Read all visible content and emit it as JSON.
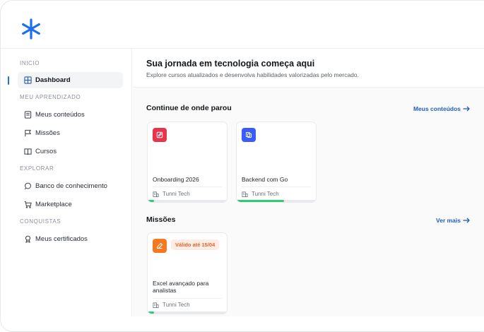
{
  "brand": {
    "logo_color": "#1f6feb"
  },
  "sidebar": {
    "sections": [
      {
        "label": "INICIO"
      },
      {
        "label": "MEU APRENDIZADO"
      },
      {
        "label": "EXPLORAR"
      },
      {
        "label": "CONQUISTAS"
      }
    ],
    "items": [
      {
        "label": "Dashboard",
        "icon": "grid-icon",
        "active": true
      },
      {
        "label": "Meus conteúdos",
        "icon": "book-icon"
      },
      {
        "label": "Missões",
        "icon": "flag-icon"
      },
      {
        "label": "Cursos",
        "icon": "open-book-icon"
      },
      {
        "label": "Banco de conhecimento",
        "icon": "search-icon"
      },
      {
        "label": "Marketplace",
        "icon": "cart-icon"
      },
      {
        "label": "Meus certificados",
        "icon": "award-icon"
      }
    ]
  },
  "hero": {
    "title": "Sua jornada em tecnologia começa aqui",
    "subtitle": "Explore cursos atualizados e desenvolva habilidades valorizadas pelo mercado."
  },
  "continue_section": {
    "title": "Continue de onde parou",
    "link": "Meus conteúdos",
    "cards": [
      {
        "title": "Onboarding 2026",
        "org": "Tunni Tech",
        "progress": 0.08,
        "badge_color": "#e5344b",
        "icon": "edit-icon"
      },
      {
        "title": "Backend com Go",
        "org": "Tunni Tech",
        "progress": 0.6,
        "badge_color": "#3b5bfd",
        "icon": "copy-icon"
      }
    ]
  },
  "missions_section": {
    "title": "Missões",
    "link": "Ver mais",
    "cards": [
      {
        "title": "Excel avançado para analistas",
        "org": "Tunni Tech",
        "tag": "Válido até 15/04",
        "progress": 0.08,
        "badge_color": "#f47a22",
        "icon": "pen-icon"
      }
    ]
  }
}
